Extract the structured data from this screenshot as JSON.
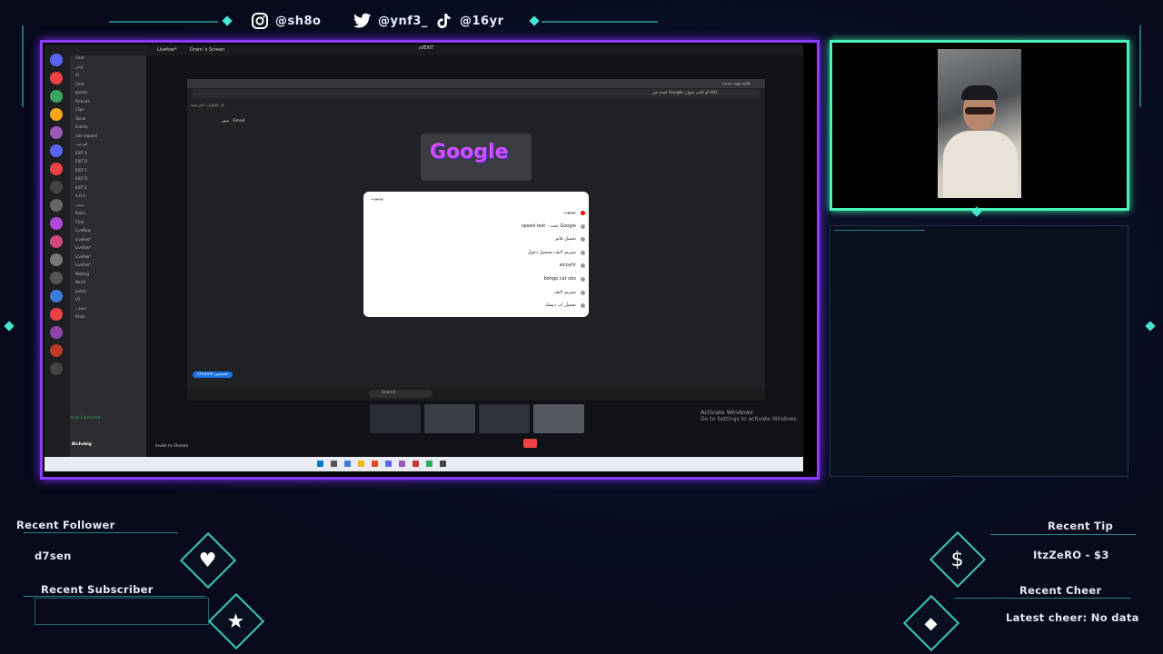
{
  "socials": [
    {
      "icon": "instagram-icon",
      "handle": "@sh8o"
    },
    {
      "icon": "twitter-icon",
      "handle": "@ynf3_"
    },
    {
      "icon": "tiktok-icon",
      "handle": "@16yr"
    }
  ],
  "capture": {
    "window_title": "𝔭𝔩/EXIT",
    "tabs": [
      "Livefow*",
      "Dram 's Screen"
    ],
    "discord": {
      "channels": [
        "Chat",
        "أوامر",
        "AI",
        "Cmd",
        "games",
        "Pictures",
        "Clips",
        "3tcuk",
        "Events",
        "role request",
        "الترحيب",
        "EXIT A",
        "EXIT B",
        "EXIT C",
        "EXIT D",
        "EXIT E",
        "S.O.S",
        "سحب",
        "Rules",
        "Chat",
        "LiveNow",
        "Livefow*",
        "Livefow*",
        "Livefow*",
        "Livefow*",
        "Waiting",
        "North",
        "public",
        "UT",
        "أعلانات",
        "Pilots"
      ],
      "voice_status": "Voice Connected",
      "user_name": "Bichebig",
      "invite_label": "Invite to Stream"
    },
    "browser": {
      "tab_label": "علامة تبويب جديدة",
      "url_placeholder": "ابحث في Google أو اكتب عنوان URL",
      "bookmarks_label": "كل الإشارات المرجعية",
      "gmail_label": "Gmail",
      "images_label": "صور",
      "search_query": "يوتيوب",
      "suggestions": [
        "يوتيوب",
        "speed test - بحث Google",
        "تحميل فانو",
        "ستريم لايف تسجيل دخول",
        "alcoyhr",
        "bongo cat obs",
        "ستريم لايف",
        "تحميل اب ديسك"
      ],
      "customize_label": "Chrome تخصيص",
      "taskbar_search": "Search"
    },
    "activate_title": "Activate Windows",
    "activate_sub": "Go to Settings to activate Windows."
  },
  "widgets": {
    "recent_follower_label": "Recent Follower",
    "recent_follower": "d7sen",
    "recent_subscriber_label": "Recent Subscriber",
    "recent_tip_label": "Recent Tip",
    "recent_tip": "ItzZeRO - $3",
    "recent_cheer_label": "Recent Cheer",
    "latest_cheer": "Latest cheer: No data"
  },
  "colors": {
    "main_border": "#8a3dff",
    "cam_border": "#49f2b6",
    "accent_cyan": "#38d8c7",
    "background": "#070a1a"
  }
}
